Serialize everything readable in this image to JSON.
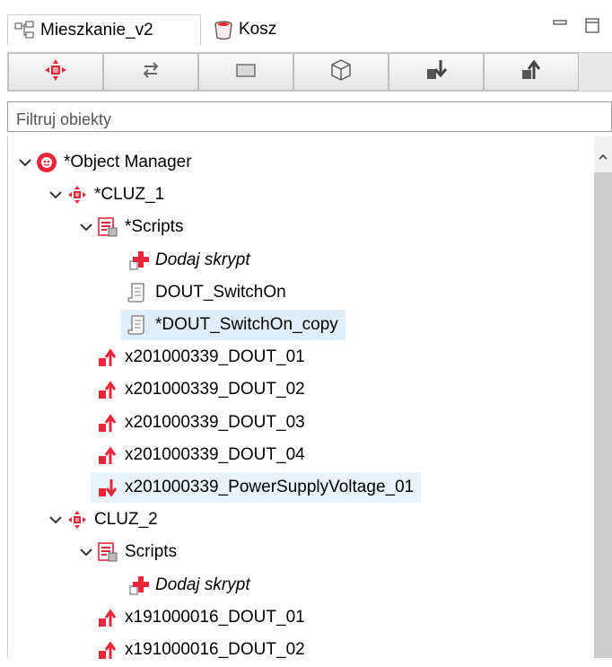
{
  "tabs": [
    {
      "label": "Mieszkanie_v2",
      "icon": "project-tree-icon",
      "active": true
    },
    {
      "label": "Kosz",
      "icon": "trash-bin-icon",
      "active": false
    }
  ],
  "window_controls": [
    "minimize-icon",
    "maximize-icon"
  ],
  "toolbar": {
    "buttons": [
      {
        "icon": "module-cluz-icon"
      },
      {
        "icon": "swap-arrows-icon"
      },
      {
        "icon": "rectangle-icon"
      },
      {
        "icon": "cube-icon"
      },
      {
        "icon": "input-arrow-down-icon"
      },
      {
        "icon": "output-arrow-up-icon"
      }
    ]
  },
  "filter": {
    "placeholder": "Filtruj obiekty",
    "value": ""
  },
  "tree": {
    "rows": [
      {
        "label": "*Object Manager",
        "depth": 0,
        "expanded": true,
        "icon": "object-manager-icon"
      },
      {
        "label": "*CLUZ_1",
        "depth": 1,
        "expanded": true,
        "icon": "module-cluz-icon"
      },
      {
        "label": "*Scripts",
        "depth": 2,
        "expanded": true,
        "icon": "scripts-folder-icon"
      },
      {
        "label": "Dodaj skrypt",
        "depth": 3,
        "icon": "add-script-icon",
        "italic": true
      },
      {
        "label": "DOUT_SwitchOn",
        "depth": 3,
        "icon": "script-document-icon"
      },
      {
        "label": "*DOUT_SwitchOn_copy",
        "depth": 3,
        "icon": "script-document-icon",
        "selected": true
      },
      {
        "label": "x201000339_DOUT_01",
        "depth": 2,
        "icon": "output-arrow-up-icon"
      },
      {
        "label": "x201000339_DOUT_02",
        "depth": 2,
        "icon": "output-arrow-up-icon"
      },
      {
        "label": "x201000339_DOUT_03",
        "depth": 2,
        "icon": "output-arrow-up-icon"
      },
      {
        "label": "x201000339_DOUT_04",
        "depth": 2,
        "icon": "output-arrow-up-icon"
      },
      {
        "label": "x201000339_PowerSupplyVoltage_01",
        "depth": 2,
        "icon": "input-arrow-down-icon",
        "highlighted": true
      },
      {
        "label": "CLUZ_2",
        "depth": 1,
        "expanded": true,
        "icon": "module-cluz-icon"
      },
      {
        "label": "Scripts",
        "depth": 2,
        "expanded": true,
        "icon": "scripts-folder-icon"
      },
      {
        "label": "Dodaj skrypt",
        "depth": 3,
        "icon": "add-script-icon",
        "italic": true
      },
      {
        "label": "x191000016_DOUT_01",
        "depth": 2,
        "icon": "output-arrow-up-icon"
      },
      {
        "label": "x191000016_DOUT_02",
        "depth": 2,
        "icon": "output-arrow-up-icon"
      }
    ]
  },
  "colors": {
    "accent_red": "#e8263a",
    "selection": "#dfeefb",
    "highlight": "#e9f3fc"
  }
}
